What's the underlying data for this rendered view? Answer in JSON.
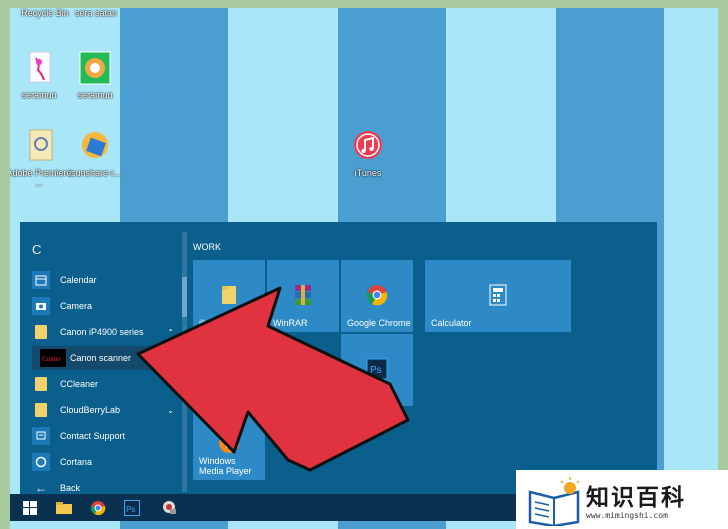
{
  "desktop": {
    "icons": [
      {
        "label": "Recycle Bin",
        "icon": "recycle-bin-icon"
      },
      {
        "label": "sera satan",
        "icon": "file-icon"
      },
      {
        "label": "seramun",
        "icon": "document-icon"
      },
      {
        "label": "seramun",
        "icon": "image-icon"
      },
      {
        "label": "Adobe Premiere ...",
        "icon": "premiere-icon"
      },
      {
        "label": "isunshare-r...",
        "icon": "isunshare-icon"
      },
      {
        "label": "iTunes",
        "icon": "itunes-icon"
      }
    ]
  },
  "start_menu": {
    "letter": "C",
    "apps": [
      {
        "label": "Calendar",
        "icon": "calendar-icon"
      },
      {
        "label": "Camera",
        "icon": "camera-icon"
      },
      {
        "label": "Canon iP4900 series",
        "icon": "folder-icon",
        "chevron": "^"
      },
      {
        "label": "Canon scanner",
        "icon": "canon-icon",
        "selected": true
      },
      {
        "label": "CCleaner",
        "icon": "folder-icon"
      },
      {
        "label": "CloudBerryLab",
        "icon": "folder-icon",
        "chevron": "v"
      },
      {
        "label": "Contact Support",
        "icon": "support-icon"
      },
      {
        "label": "Cortana",
        "icon": "cortana-icon"
      }
    ],
    "back_label": "Back",
    "group_title": "WORK",
    "tiles": [
      {
        "label": "illustrations",
        "icon": "folder-icon"
      },
      {
        "label": "WinRAR",
        "icon": "winrar-icon"
      },
      {
        "label": "Google Chrome",
        "icon": "chrome-icon"
      },
      {
        "label": "Calculator",
        "icon": "calculator-icon"
      },
      {
        "label": "Adobe Photoshop...",
        "icon": "photoshop-icon"
      },
      {
        "label": "Windows Media Player",
        "icon": "media-player-icon"
      }
    ]
  },
  "taskbar": {
    "items": [
      "windows-start-icon",
      "file-explorer-icon",
      "chrome-icon",
      "photoshop-icon",
      "app-icon"
    ]
  },
  "watermark": {
    "title": "知识百科",
    "url": "www.mimingshi.com"
  },
  "colors": {
    "start_bg": "#0b5f8c",
    "tile_bg": "#2d8ac6",
    "arrow": "#e0323f"
  }
}
